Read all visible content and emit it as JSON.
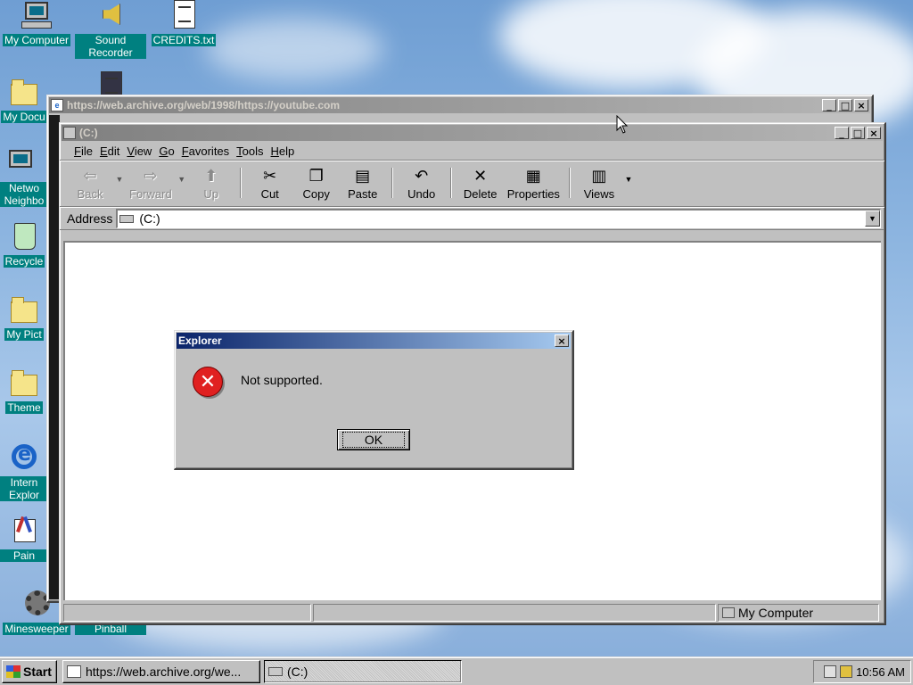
{
  "desktop": {
    "icons": [
      {
        "label": "My Computer"
      },
      {
        "label": "Sound Recorder"
      },
      {
        "label": "CREDITS.txt"
      },
      {
        "label": "My Docu"
      },
      {
        "label": "Netwo Neighbo"
      },
      {
        "label": "Recycle"
      },
      {
        "label": "My Pict"
      },
      {
        "label": "Theme"
      },
      {
        "label": "Intern Explor"
      },
      {
        "label": "Pain"
      },
      {
        "label": "Minesweeper"
      },
      {
        "label": "Pinball"
      }
    ]
  },
  "back_window": {
    "title": "https://web.archive.org/web/1998/https://youtube.com",
    "controls": {
      "minimize": "_",
      "maximize": "□",
      "close": "×"
    }
  },
  "explorer": {
    "title": "(C:)",
    "controls": {
      "minimize": "_",
      "maximize": "□",
      "close": "×"
    },
    "menu": [
      {
        "key": "F",
        "rest": "ile"
      },
      {
        "key": "E",
        "rest": "dit"
      },
      {
        "key": "V",
        "rest": "iew"
      },
      {
        "key": "G",
        "rest": "o"
      },
      {
        "key": "F",
        "rest": "avorites",
        "pre": "",
        "full": "Favorites"
      },
      {
        "key": "T",
        "rest": "ools"
      },
      {
        "key": "H",
        "rest": "elp"
      }
    ],
    "toolbar": {
      "back": "Back",
      "forward": "Forward",
      "up": "Up",
      "cut": "Cut",
      "copy": "Copy",
      "paste": "Paste",
      "undo": "Undo",
      "delete": "Delete",
      "properties": "Properties",
      "views": "Views"
    },
    "address": {
      "label": "Address",
      "value": "(C:)"
    },
    "status": {
      "location": "My Computer"
    }
  },
  "dialog": {
    "title": "Explorer",
    "message": "Not supported.",
    "ok_label": "OK",
    "close": "×"
  },
  "taskbar": {
    "start_label": "Start",
    "items": [
      {
        "label": "https://web.archive.org/we..."
      },
      {
        "label": "(C:)"
      }
    ],
    "clock": "10:56 AM"
  }
}
